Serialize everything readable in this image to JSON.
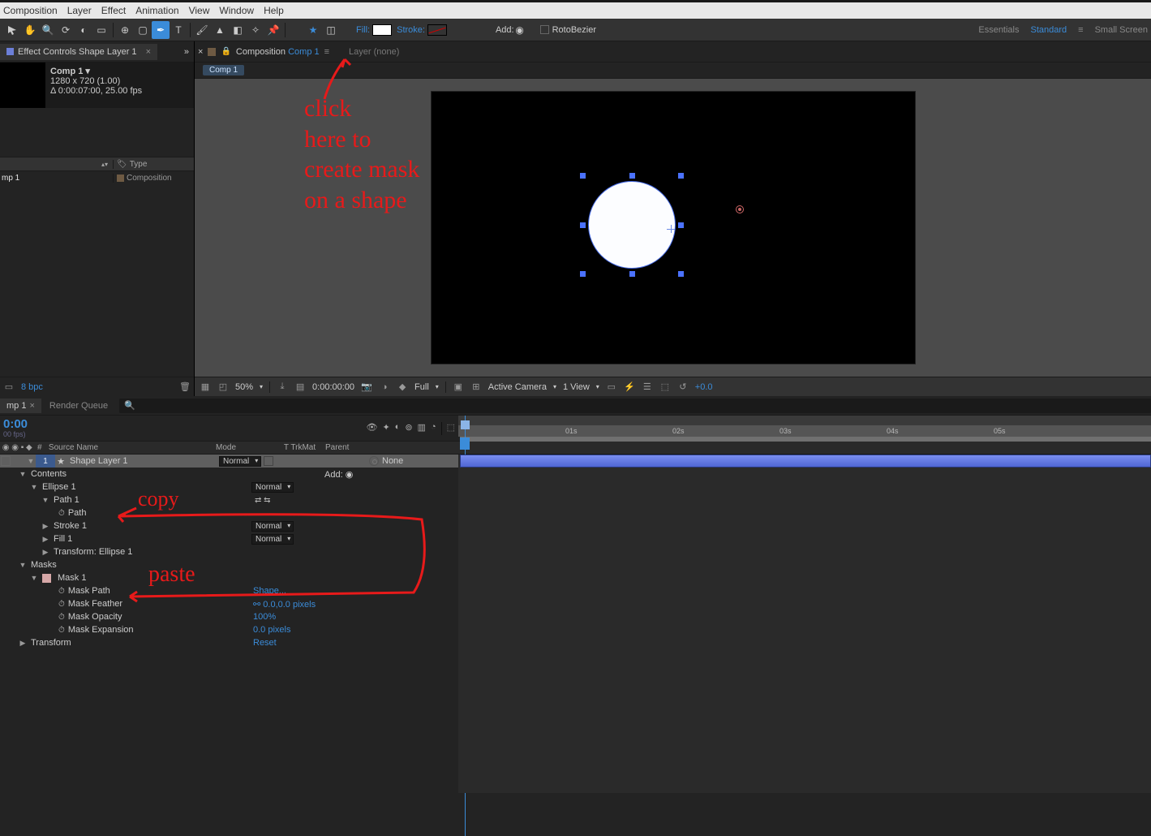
{
  "menu": [
    "Composition",
    "Layer",
    "Effect",
    "Animation",
    "View",
    "Window",
    "Help"
  ],
  "optbar": {
    "fill_label": "Fill:",
    "stroke_label": "Stroke:",
    "add_label": "Add:",
    "rotobezier": "RotoBezier"
  },
  "workspaces": {
    "items": [
      "Essentials",
      "Standard",
      "Small Screen"
    ],
    "active": "Standard"
  },
  "effect_panel": {
    "tab": "Effect Controls Shape Layer 1"
  },
  "comp_info": {
    "name": "Comp 1",
    "dims": "1280 x 720 (1.00)",
    "dur": "Δ 0:00:07:00, 25.00 fps"
  },
  "proj_head": {
    "name_col": "",
    "type_col": "Type"
  },
  "proj_rows": [
    {
      "name": "mp 1",
      "type": "Composition"
    }
  ],
  "proj_foot": {
    "bpc": "8 bpc"
  },
  "comp_tabs": {
    "lock_prefix": "×",
    "comp_word": "Composition",
    "comp_link": "Comp 1",
    "layer_tab": "Layer (none)"
  },
  "crumb": "Comp 1",
  "viewer_foot": {
    "zoom": "50%",
    "timecode": "0:00:00:00",
    "res": "Full",
    "camera": "Active Camera",
    "views": "1 View",
    "exposure": "+0.0"
  },
  "timeline_tabs": {
    "active": "mp 1",
    "second": "Render Queue"
  },
  "timeline_head": {
    "tc": "0:00",
    "fps": "00 fps)"
  },
  "ruler_ticks": [
    "01s",
    "02s",
    "03s",
    "04s",
    "05s"
  ],
  "tl_cols": {
    "idx": "#",
    "src": "Source Name",
    "mode": "Mode",
    "trk": "T  TrkMat",
    "parent": "Parent"
  },
  "layer": {
    "index": "1",
    "name": "Shape Layer 1",
    "mode": "Normal",
    "parent": "None"
  },
  "props": {
    "contents": "Contents",
    "add": "Add:",
    "ellipse": "Ellipse 1",
    "ellipse_mode": "Normal",
    "path1": "Path 1",
    "path": "Path",
    "stroke1": "Stroke 1",
    "stroke1_mode": "Normal",
    "fill1": "Fill 1",
    "fill1_mode": "Normal",
    "transform_e": "Transform: Ellipse 1",
    "masks": "Masks",
    "mask1": "Mask 1",
    "mask_path": "Mask Path",
    "mask_path_val": "Shape...",
    "mask_feather": "Mask Feather",
    "mask_feather_val": "0.0,0.0 pixels",
    "mask_opacity": "Mask Opacity",
    "mask_opacity_val": "100%",
    "mask_expansion": "Mask Expansion",
    "mask_expansion_val": "0.0 pixels",
    "transform": "Transform",
    "transform_val": "Reset"
  },
  "annotations": {
    "a1": "click\nhere to\ncreate mask\non a shape",
    "a2": "copy",
    "a3": "paste"
  }
}
